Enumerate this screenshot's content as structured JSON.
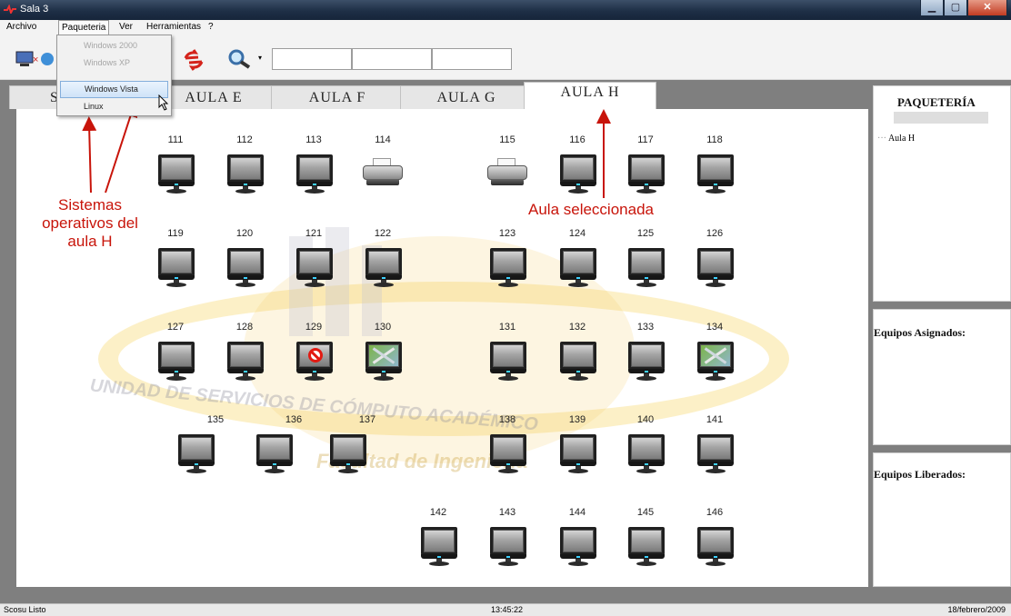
{
  "window": {
    "title": "Sala 3"
  },
  "menu": [
    "Archivo",
    "Paqueteria",
    "Ver",
    "Herramientas",
    "?"
  ],
  "paqueteria_menu": {
    "items": [
      {
        "label": "Windows 2000",
        "enabled": false
      },
      {
        "label": "Windows XP",
        "enabled": false
      },
      {
        "label": "Windows Vista",
        "enabled": true,
        "highlighted": true
      },
      {
        "label": "Linux",
        "enabled": true
      }
    ]
  },
  "toolbar": {
    "icons": [
      "network-disconnect-icon",
      "refresh-icon",
      "search-icon",
      "dropdown-arrow-icon"
    ],
    "fields": [
      "",
      "",
      ""
    ]
  },
  "tabs": [
    {
      "label": "S",
      "selected": false
    },
    {
      "label": "AULA E",
      "selected": false
    },
    {
      "label": "AULA F",
      "selected": false
    },
    {
      "label": "AULA G",
      "selected": false
    },
    {
      "label": "AULA H",
      "selected": true
    }
  ],
  "room": {
    "watermark": {
      "line1": "UNIDAD DE SERVICIOS DE CÓMPUTO ACADÉMICO",
      "line2": "Facultad de Ingeniería",
      "colors": [
        "#f2c95a",
        "#f8dd82",
        "#c6c6d2"
      ]
    },
    "stations": [
      {
        "number": "111",
        "type": "pc",
        "status": "normal"
      },
      {
        "number": "112",
        "type": "pc",
        "status": "normal"
      },
      {
        "number": "113",
        "type": "pc",
        "status": "normal"
      },
      {
        "number": "114",
        "type": "printer",
        "status": "normal"
      },
      {
        "number": "115",
        "type": "printer",
        "status": "normal"
      },
      {
        "number": "116",
        "type": "pc",
        "status": "normal"
      },
      {
        "number": "117",
        "type": "pc",
        "status": "normal"
      },
      {
        "number": "118",
        "type": "pc",
        "status": "normal"
      },
      {
        "number": "119",
        "type": "pc",
        "status": "normal"
      },
      {
        "number": "120",
        "type": "pc",
        "status": "normal"
      },
      {
        "number": "121",
        "type": "pc",
        "status": "normal"
      },
      {
        "number": "122",
        "type": "pc",
        "status": "normal"
      },
      {
        "number": "123",
        "type": "pc",
        "status": "normal"
      },
      {
        "number": "124",
        "type": "pc",
        "status": "normal"
      },
      {
        "number": "125",
        "type": "pc",
        "status": "normal"
      },
      {
        "number": "126",
        "type": "pc",
        "status": "normal"
      },
      {
        "number": "127",
        "type": "pc",
        "status": "normal"
      },
      {
        "number": "128",
        "type": "pc",
        "status": "normal"
      },
      {
        "number": "129",
        "type": "pc",
        "status": "blocked"
      },
      {
        "number": "130",
        "type": "pc",
        "status": "maintenance"
      },
      {
        "number": "131",
        "type": "pc",
        "status": "normal"
      },
      {
        "number": "132",
        "type": "pc",
        "status": "normal"
      },
      {
        "number": "133",
        "type": "pc",
        "status": "normal"
      },
      {
        "number": "134",
        "type": "pc",
        "status": "maintenance"
      },
      {
        "number": "135",
        "type": "pc",
        "status": "normal"
      },
      {
        "number": "136",
        "type": "pc",
        "status": "normal"
      },
      {
        "number": "137",
        "type": "pc",
        "status": "normal"
      },
      {
        "number": "138",
        "type": "pc",
        "status": "normal"
      },
      {
        "number": "139",
        "type": "pc",
        "status": "normal"
      },
      {
        "number": "140",
        "type": "pc",
        "status": "normal"
      },
      {
        "number": "141",
        "type": "pc",
        "status": "normal"
      },
      {
        "number": "142",
        "type": "pc",
        "status": "normal"
      },
      {
        "number": "143",
        "type": "pc",
        "status": "normal"
      },
      {
        "number": "144",
        "type": "pc",
        "status": "normal"
      },
      {
        "number": "145",
        "type": "pc",
        "status": "normal"
      },
      {
        "number": "146",
        "type": "pc",
        "status": "normal"
      }
    ]
  },
  "annotations": {
    "left": [
      "Sistemas",
      "operativos del",
      "aula H"
    ],
    "right": "Aula seleccionada",
    "color": "#c8140a"
  },
  "right_panel": {
    "heading": "PAQUETERÍA",
    "tree_item": "Aula H",
    "assigned_heading": "Equipos Asignados:",
    "released_heading": "Equipos Liberados:"
  },
  "statusbar": {
    "left": "Scosu Listo",
    "time": "13:45:22",
    "date": "18/febrero/2009"
  }
}
